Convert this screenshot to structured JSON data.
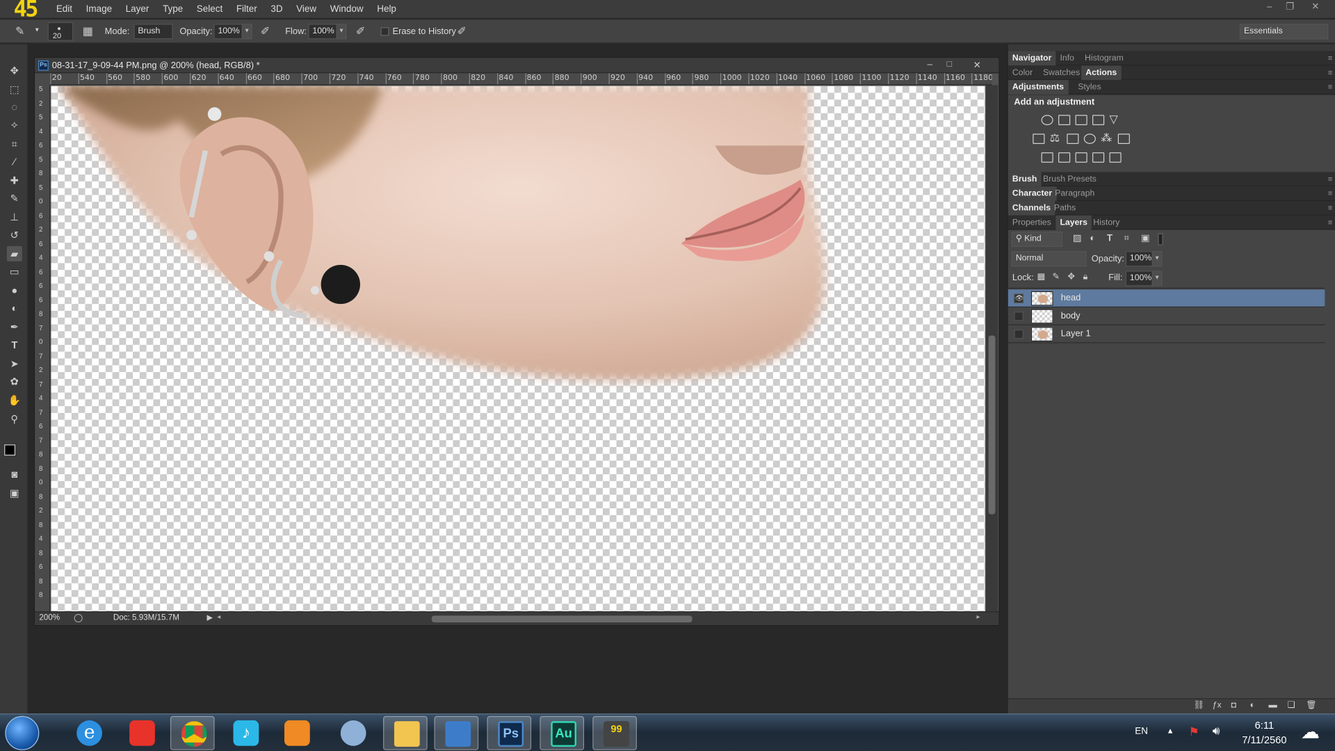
{
  "fps_counter": "45",
  "menu": [
    "Edit",
    "Image",
    "Layer",
    "Type",
    "Select",
    "Filter",
    "3D",
    "View",
    "Window",
    "Help"
  ],
  "options_bar": {
    "brush_size": "20",
    "mode_label": "Mode:",
    "mode_value": "Brush",
    "opacity_label": "Opacity:",
    "opacity_value": "100%",
    "flow_label": "Flow:",
    "flow_value": "100%",
    "erase_history_label": "Erase to History",
    "workspace_value": "Essentials"
  },
  "document": {
    "title": "08-31-17_9-09-44 PM.png @ 200% (head, RGB/8) *",
    "ps_icon": "Ps",
    "zoom": "200%",
    "doc_size": "Doc: 5.93M/15.7M",
    "ruler_h": [
      "20",
      "540",
      "560",
      "580",
      "600",
      "620",
      "640",
      "660",
      "680",
      "700",
      "720",
      "740",
      "760",
      "780",
      "800",
      "820",
      "840",
      "860",
      "880",
      "900",
      "920",
      "940",
      "960",
      "980",
      "1000",
      "1020",
      "1040",
      "1060",
      "1080",
      "1100",
      "1120",
      "1140",
      "1160",
      "1180"
    ],
    "ruler_v": [
      "5",
      "2",
      "5",
      "4",
      "6",
      "5",
      "8",
      "5",
      "0",
      "6",
      "2",
      "6",
      "4",
      "6",
      "6",
      "6",
      "8",
      "7",
      "0",
      "7",
      "2",
      "7",
      "4",
      "7",
      "6",
      "7",
      "8",
      "8",
      "0",
      "8",
      "2",
      "8",
      "4",
      "8",
      "6",
      "8",
      "8"
    ]
  },
  "panels": {
    "row1_tabs": [
      "Navigator",
      "Info",
      "Histogram"
    ],
    "row2_tabs": [
      "Color",
      "Swatches",
      "Actions"
    ],
    "row3_tabs": [
      "Adjustments",
      "Styles"
    ],
    "adjust_header": "Add an adjustment",
    "brush_tabs": [
      "Brush",
      "Brush Presets"
    ],
    "char_tabs": [
      "Character",
      "Paragraph"
    ],
    "channel_tabs": [
      "Channels",
      "Paths"
    ],
    "layer_tabs": [
      "Properties",
      "Layers",
      "History"
    ],
    "kind_value": "Kind",
    "blend_value": "Normal",
    "opacity_label": "Opacity:",
    "opacity_value": "100%",
    "lock_label": "Lock:",
    "fill_label": "Fill:",
    "fill_value": "100%",
    "layers": [
      {
        "name": "head",
        "visible": true,
        "selected": true
      },
      {
        "name": "body",
        "visible": false,
        "selected": false
      },
      {
        "name": "Layer 1",
        "visible": false,
        "selected": false
      }
    ]
  },
  "taskbar": {
    "apps": [
      "start-orb",
      "internet-explorer",
      "weibo",
      "chrome",
      "music-player",
      "media-player",
      "steam",
      "file-explorer",
      "remote-desktop",
      "photoshop",
      "audition",
      "benchmark"
    ],
    "lang": "EN",
    "time": "6:11",
    "date": "7/11/2560"
  },
  "colors": {
    "accent": "#5e7a9e",
    "bg": "#282828",
    "fps": "#f2d410"
  }
}
